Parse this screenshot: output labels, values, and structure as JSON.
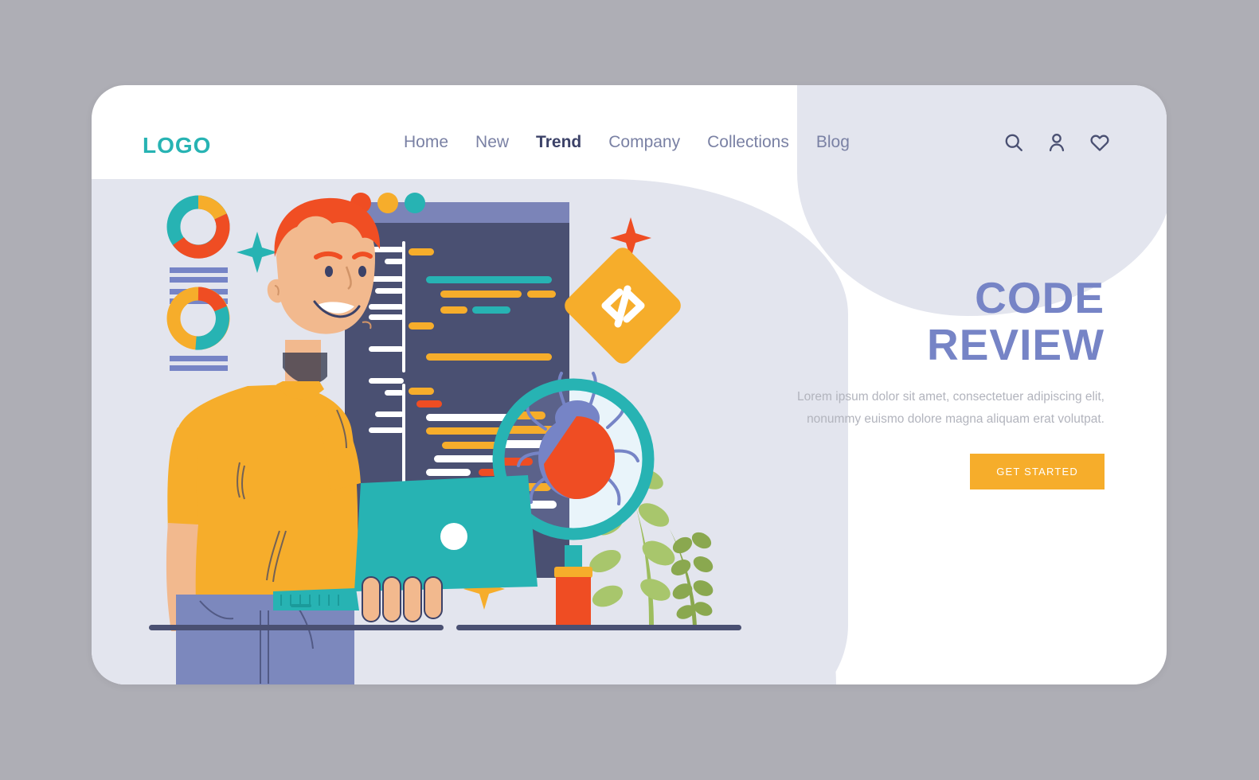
{
  "brand": {
    "logo_text": "LOGO",
    "logo_color": "#27b3b3"
  },
  "nav": {
    "items": [
      {
        "label": "Home",
        "active": false
      },
      {
        "label": "New",
        "active": false
      },
      {
        "label": "Trend",
        "active": true
      },
      {
        "label": "Company",
        "active": false
      },
      {
        "label": "Collections",
        "active": false
      },
      {
        "label": "Blog",
        "active": false
      }
    ],
    "icons": [
      "search-icon",
      "user-icon",
      "heart-icon"
    ]
  },
  "hero": {
    "title_line1": "CODE",
    "title_line2": "REVIEW",
    "title_color": "#7684c6",
    "subtitle": "Lorem ipsum dolor sit amet, consectetuer adipiscing elit, nonummy euismo dolore magna aliquam erat volutpat.",
    "cta_label": "GET STARTED",
    "cta_color": "#f6ad2b"
  },
  "illustration": {
    "name": "code-review-illustration",
    "elements": [
      "donut-chart-top",
      "donut-chart-bottom",
      "bar-lines",
      "teal-sparkle",
      "orange-sparkle",
      "yellow-sparkle",
      "code-editor-window",
      "code-diamond-badge",
      "developer-character",
      "teal-laptop",
      "magnifying-glass",
      "bug",
      "plant",
      "ground-lines"
    ],
    "code_badge_glyph": "</>",
    "window_dots": [
      "#ef4d23",
      "#f6ad2b",
      "#27b3b3"
    ]
  },
  "colors": {
    "page_background": "#aeaeb5",
    "card_background": "#ffffff",
    "blob": "#e3e5ee",
    "editor_dark": "#4a5072",
    "editor_bar": "#7b84b8",
    "teal": "#27b3b3",
    "orange": "#ef4d23",
    "amber": "#f6ad2b",
    "periwinkle": "#7684c6",
    "skin": "#f2b98e",
    "hair": "#f04e23",
    "shirt": "#f6ad2b",
    "jeans": "#7c88bd",
    "plant_green": "#a8c66c",
    "ground": "#4a5072"
  }
}
